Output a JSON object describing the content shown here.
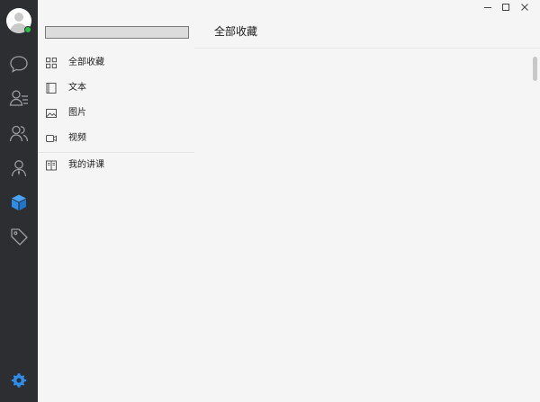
{
  "window": {
    "controls": {
      "minimize_icon": "minimize-icon",
      "maximize_icon": "maximize-icon",
      "close_icon": "close-icon"
    }
  },
  "rail": {
    "avatar": {
      "status": "online",
      "status_color": "#2bc24b"
    },
    "items": [
      {
        "icon": "chat-icon",
        "active": false
      },
      {
        "icon": "contacts-icon",
        "active": false
      },
      {
        "icon": "group-icon",
        "active": false
      },
      {
        "icon": "profile-icon",
        "active": false
      },
      {
        "icon": "favorites-cube-icon",
        "active": true,
        "color": "#2f8dea"
      },
      {
        "icon": "tag-icon",
        "active": false
      }
    ],
    "settings_icon": "gear-icon",
    "settings_color": "#2f8dea"
  },
  "search": {
    "placeholder": "",
    "value": ""
  },
  "nav": {
    "items": [
      {
        "label": "全部收藏",
        "icon": "grid-icon"
      },
      {
        "label": "文本",
        "icon": "book-icon"
      },
      {
        "label": "图片",
        "icon": "image-icon"
      },
      {
        "label": "视频",
        "icon": "video-icon"
      },
      {
        "label": "我的讲课",
        "icon": "lecture-icon"
      }
    ]
  },
  "content": {
    "title": "全部收藏"
  }
}
